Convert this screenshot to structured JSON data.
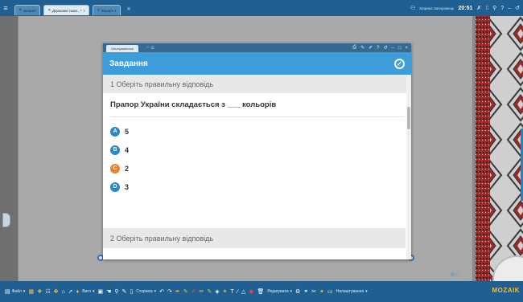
{
  "topbar": {
    "tabs": [
      {
        "label": "зошит*",
        "active": false
      },
      {
        "label": "Державні симв...*",
        "active": true
      },
      {
        "label": "Зошит 1",
        "active": false
      }
    ],
    "more": "»",
    "user": "Марина Запорожець",
    "time": "20:51"
  },
  "dialog": {
    "tab_label": "Опитувальник",
    "header_title": "Завдання",
    "question1": {
      "heading": "1 Оберіть правильну відповідь",
      "text": "Прапор України складається з ___ кольорів",
      "options": [
        {
          "letter": "A",
          "text": "5",
          "color": "#2e86c9"
        },
        {
          "letter": "B",
          "text": "4",
          "color": "#2e86c9"
        },
        {
          "letter": "C",
          "text": "2",
          "color": "#f07f2a"
        },
        {
          "letter": "D",
          "text": "3",
          "color": "#2e86c9"
        }
      ]
    },
    "question2": {
      "heading": "2 Оберіть правильну відповідь"
    }
  },
  "bottombar": {
    "file": "Файл",
    "view": "Вигл",
    "page": "Сторінка",
    "edit": "Редагувати",
    "settings": "Налаштування",
    "brand": "MOZAIK"
  },
  "colors": {
    "bar_blue": "#1f5f92",
    "header_blue": "#3d9ddb",
    "accent_orange": "#f07f2a"
  }
}
